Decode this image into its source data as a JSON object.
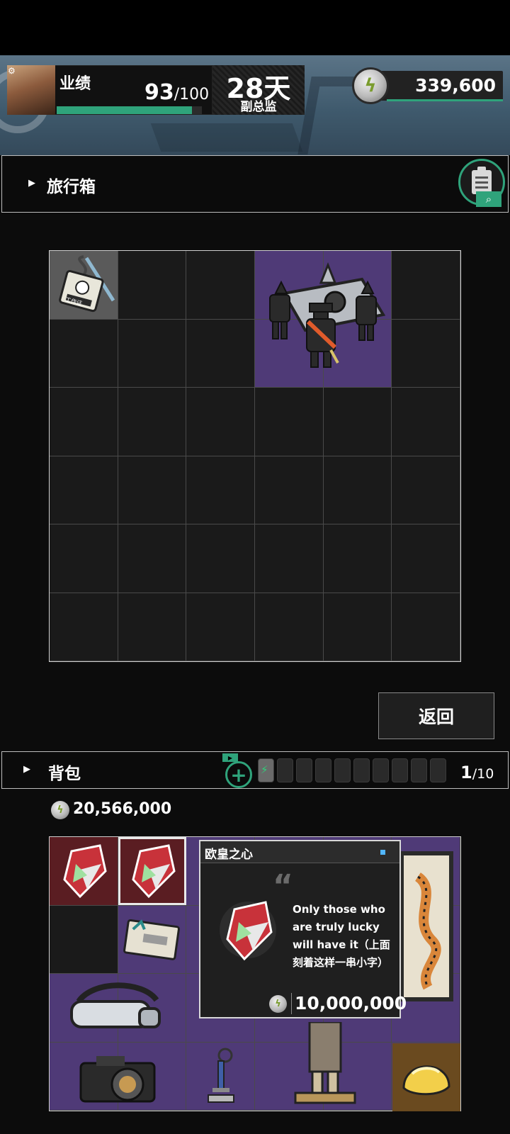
{
  "header": {
    "performance_label": "业绩",
    "performance_value": "93",
    "performance_max": "/100",
    "performance_progress": 0.93,
    "days_value": "28天",
    "rank_label": "副总监",
    "currency_value": "339,600"
  },
  "suitcase": {
    "title": "旅行箱",
    "rows": 6,
    "cols": 6,
    "items": [
      {
        "name": "work-badge",
        "label": "工作证"
      },
      {
        "name": "coffin-dance-figure"
      }
    ]
  },
  "return_label": "返回",
  "backpack": {
    "title": "背包",
    "slot_count": "1",
    "slot_max": "/10",
    "total_value": "20,566,000",
    "items": [
      {
        "name": "lucky-heart-gem"
      },
      {
        "name": "lucky-heart-gem"
      },
      {
        "name": "ticket-card"
      },
      {
        "name": "vr-headset"
      },
      {
        "name": "camera"
      },
      {
        "name": "sword-keychain"
      },
      {
        "name": "statue"
      },
      {
        "name": "tiger-painting"
      },
      {
        "name": "gold-bun"
      }
    ]
  },
  "tooltip": {
    "title": "欧皇之心",
    "description": "Only those who are truly lucky will have it（上面刻着这样一串小字）",
    "price": "10,000,000"
  },
  "colors": {
    "accent": "#2fa37b",
    "rare_purple": "#4f3a77",
    "epic_maroon": "#5a1d22",
    "tooltip_dot": "#52b6ff"
  }
}
